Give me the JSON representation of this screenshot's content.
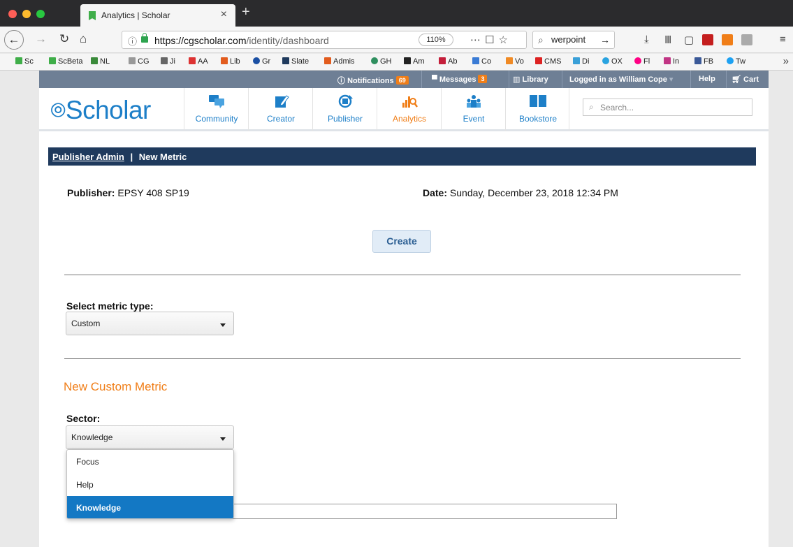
{
  "browser": {
    "tab_title": "Analytics | Scholar",
    "tab_close": "×",
    "new_tab": "+",
    "url_host": "https://cgscholar.com",
    "url_path": "/identity/dashboard",
    "zoom": "110%",
    "search_text": "​werpoint",
    "bookmarks": [
      "Sc",
      "ScBeta",
      "NL",
      "CG",
      "Ji",
      "AA",
      "Lib",
      "Gr",
      "Slate",
      "Admis",
      "GH",
      "Am",
      "Ab",
      "Co",
      "Vo",
      "CMS",
      "Di",
      "OX",
      "Fl",
      "In",
      "FB",
      "Tw"
    ],
    "colors": {
      "chrome_dark": "#2b2b2d",
      "secure_green": "#2ea44f"
    }
  },
  "userbar": {
    "notifications_label": "Notifications",
    "notifications_count": "69",
    "messages_label": "Messages",
    "messages_count": "3",
    "library_label": "Library",
    "logged_in_label": "Logged in as William Cope",
    "help_label": "Help",
    "cart_label": "Cart"
  },
  "header": {
    "logo": "Scholar",
    "nav": [
      {
        "label": "Community",
        "icon": "chat-bubbles-icon"
      },
      {
        "label": "Creator",
        "icon": "pencil-note-icon"
      },
      {
        "label": "Publisher",
        "icon": "publish-cycle-icon"
      },
      {
        "label": "Analytics",
        "icon": "bar-chart-magnifier-icon"
      },
      {
        "label": "Event",
        "icon": "people-group-icon"
      },
      {
        "label": "Bookstore",
        "icon": "open-book-icon"
      }
    ],
    "search_placeholder": "Search..."
  },
  "breadcrumb": {
    "link": "Publisher Admin",
    "separator": "|",
    "current": "New Metric"
  },
  "meta": {
    "publisher_label": "Publisher:",
    "publisher_value": "EPSY 408 SP19",
    "date_label": "Date:",
    "date_value": "Sunday, December 23, 2018 12:34 PM"
  },
  "create_button": "Create",
  "metric_type": {
    "label": "Select metric type:",
    "value": "Custom"
  },
  "section_title": "New Custom Metric",
  "sector": {
    "label": "Sector:",
    "value": "Knowledge",
    "options": [
      "Focus",
      "Help",
      "Knowledge"
    ],
    "selected": "Knowledge"
  },
  "colors": {
    "brand_blue": "#1d7fc8",
    "accent_orange": "#f07e18",
    "crumb_navy": "#1f3a5d",
    "selected_blue": "#1378c4"
  }
}
